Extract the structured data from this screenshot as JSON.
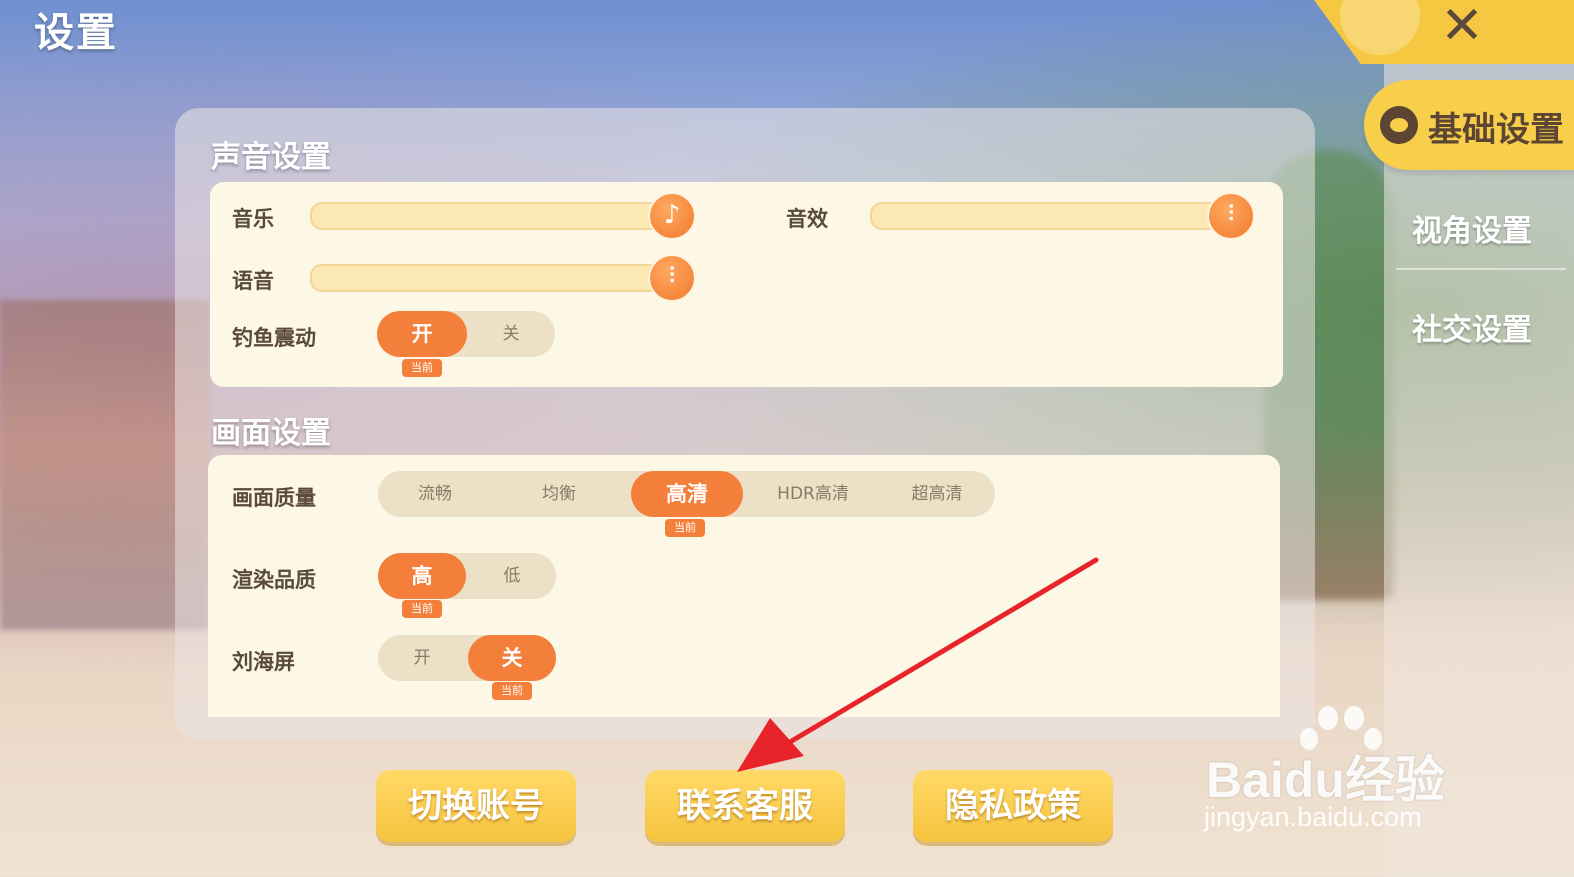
{
  "window": {
    "title": "设置"
  },
  "sidebar": {
    "items": [
      {
        "label": "基础设置",
        "active": true
      },
      {
        "label": "视角设置",
        "active": false
      },
      {
        "label": "社交设置",
        "active": false
      }
    ]
  },
  "sound": {
    "title": "声音设置",
    "music": {
      "label": "音乐",
      "level": 1.0,
      "icon": "music-note-icon"
    },
    "sfx": {
      "label": "音效",
      "level": 1.0,
      "icon": "equalizer-icon"
    },
    "voice": {
      "label": "语音",
      "level": 1.0,
      "icon": "equalizer-icon"
    },
    "vibration": {
      "label": "钓鱼震动",
      "options": [
        "开",
        "关"
      ],
      "selected": "开",
      "badge": "当前"
    }
  },
  "graphics": {
    "title": "画面设置",
    "quality": {
      "label": "画面质量",
      "options": [
        "流畅",
        "均衡",
        "高清",
        "HDR高清",
        "超高清"
      ],
      "selected": "高清",
      "badge": "当前"
    },
    "render": {
      "label": "渲染品质",
      "options": [
        "高",
        "低"
      ],
      "selected": "高",
      "badge": "当前"
    },
    "notch": {
      "label": "刘海屏",
      "options": [
        "开",
        "关"
      ],
      "selected": "关",
      "badge": "当前"
    }
  },
  "buttons": {
    "switch_account": "切换账号",
    "contact_support": "联系客服",
    "privacy_policy": "隐私政策"
  },
  "watermark": {
    "brand": "Baidu经验",
    "url": "jingyan.baidu.com"
  },
  "colors": {
    "accent": "#f47f3a",
    "nav_active": "#f8cf4a",
    "button": "#f5c33d",
    "annotation_arrow": "#e8232a"
  }
}
